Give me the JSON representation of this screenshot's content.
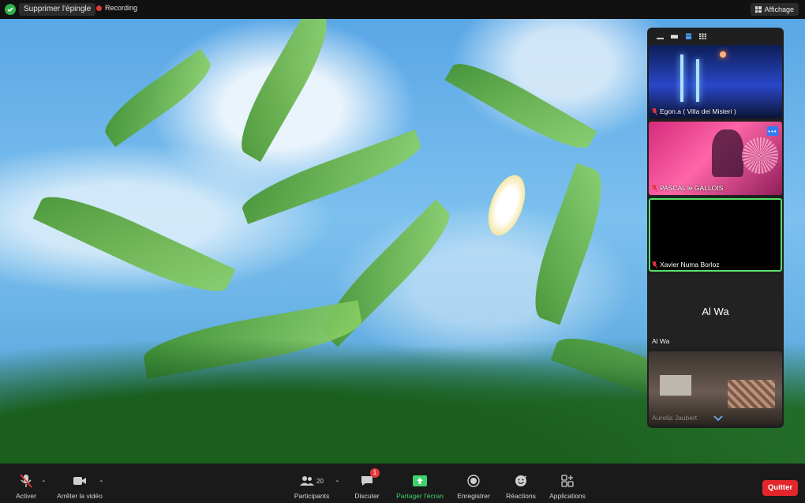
{
  "topbar": {
    "unpin_label": "Supprimer l'épingle",
    "recording_label": "Recording",
    "view_label": "Affichage"
  },
  "gallery": {
    "layout_icons": [
      "minimize-icon",
      "strip-icon",
      "speaker-icon",
      "grid-icon"
    ],
    "participants": [
      {
        "name": "Egon.a ( Villa dei Misteri )",
        "muted": true
      },
      {
        "name": "PASCAL le GALLOIS",
        "muted": true
      },
      {
        "name": "Xavier Numa Borloz",
        "muted": true
      },
      {
        "name": "Al Wa",
        "muted": false,
        "initials": "Al Wa"
      },
      {
        "name": "Aurelia Jaubert",
        "muted": false
      }
    ],
    "more_label": "•••"
  },
  "toolbar": {
    "mute_label": "Activer",
    "video_label": "Arrêter la vidéo",
    "participants_label": "Participants",
    "participants_count": "20",
    "chat_label": "Discuter",
    "chat_badge": "1",
    "share_label": "Partager l'écran",
    "record_label": "Enregistrer",
    "reactions_label": "Réactions",
    "apps_label": "Applications",
    "quit_label": "Quitter"
  },
  "colors": {
    "accent_green": "#3bd36b",
    "quit_red": "#e2262c",
    "active_speaker_outline": "#5be06a",
    "badge_red": "#e5383b"
  }
}
